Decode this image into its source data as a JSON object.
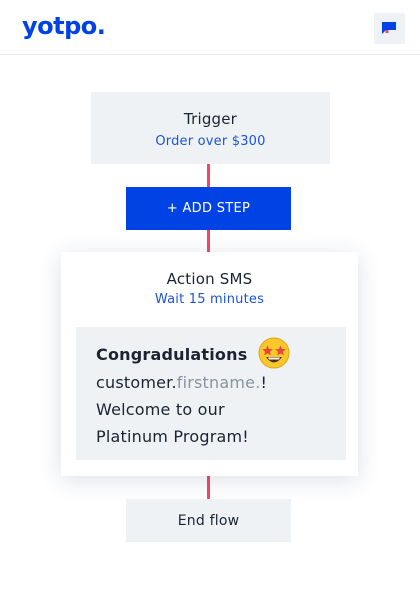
{
  "header": {
    "logo_text": "yotpo.",
    "chat_icon": "chat-bubble-icon"
  },
  "trigger": {
    "title": "Trigger",
    "subtitle": "Order over $300"
  },
  "add_step": {
    "label": "+ ADD STEP"
  },
  "action": {
    "title": "Action SMS",
    "subtitle": "Wait 15 minutes",
    "message": {
      "line1": "Congradulations",
      "emoji": "star-struck-emoji",
      "line2_prefix": "customer.",
      "line2_variable": "firstname.",
      "line2_suffix": "!",
      "line3": "Welcome to our",
      "line4": "Platinum Program!"
    }
  },
  "end_flow": {
    "label": "End flow"
  },
  "colors": {
    "brand_blue": "#0042e4",
    "connector_red": "#f2475f",
    "card_gray": "#eef2f5",
    "link_blue": "#1b54d9",
    "variable_gray": "#8993a1"
  }
}
